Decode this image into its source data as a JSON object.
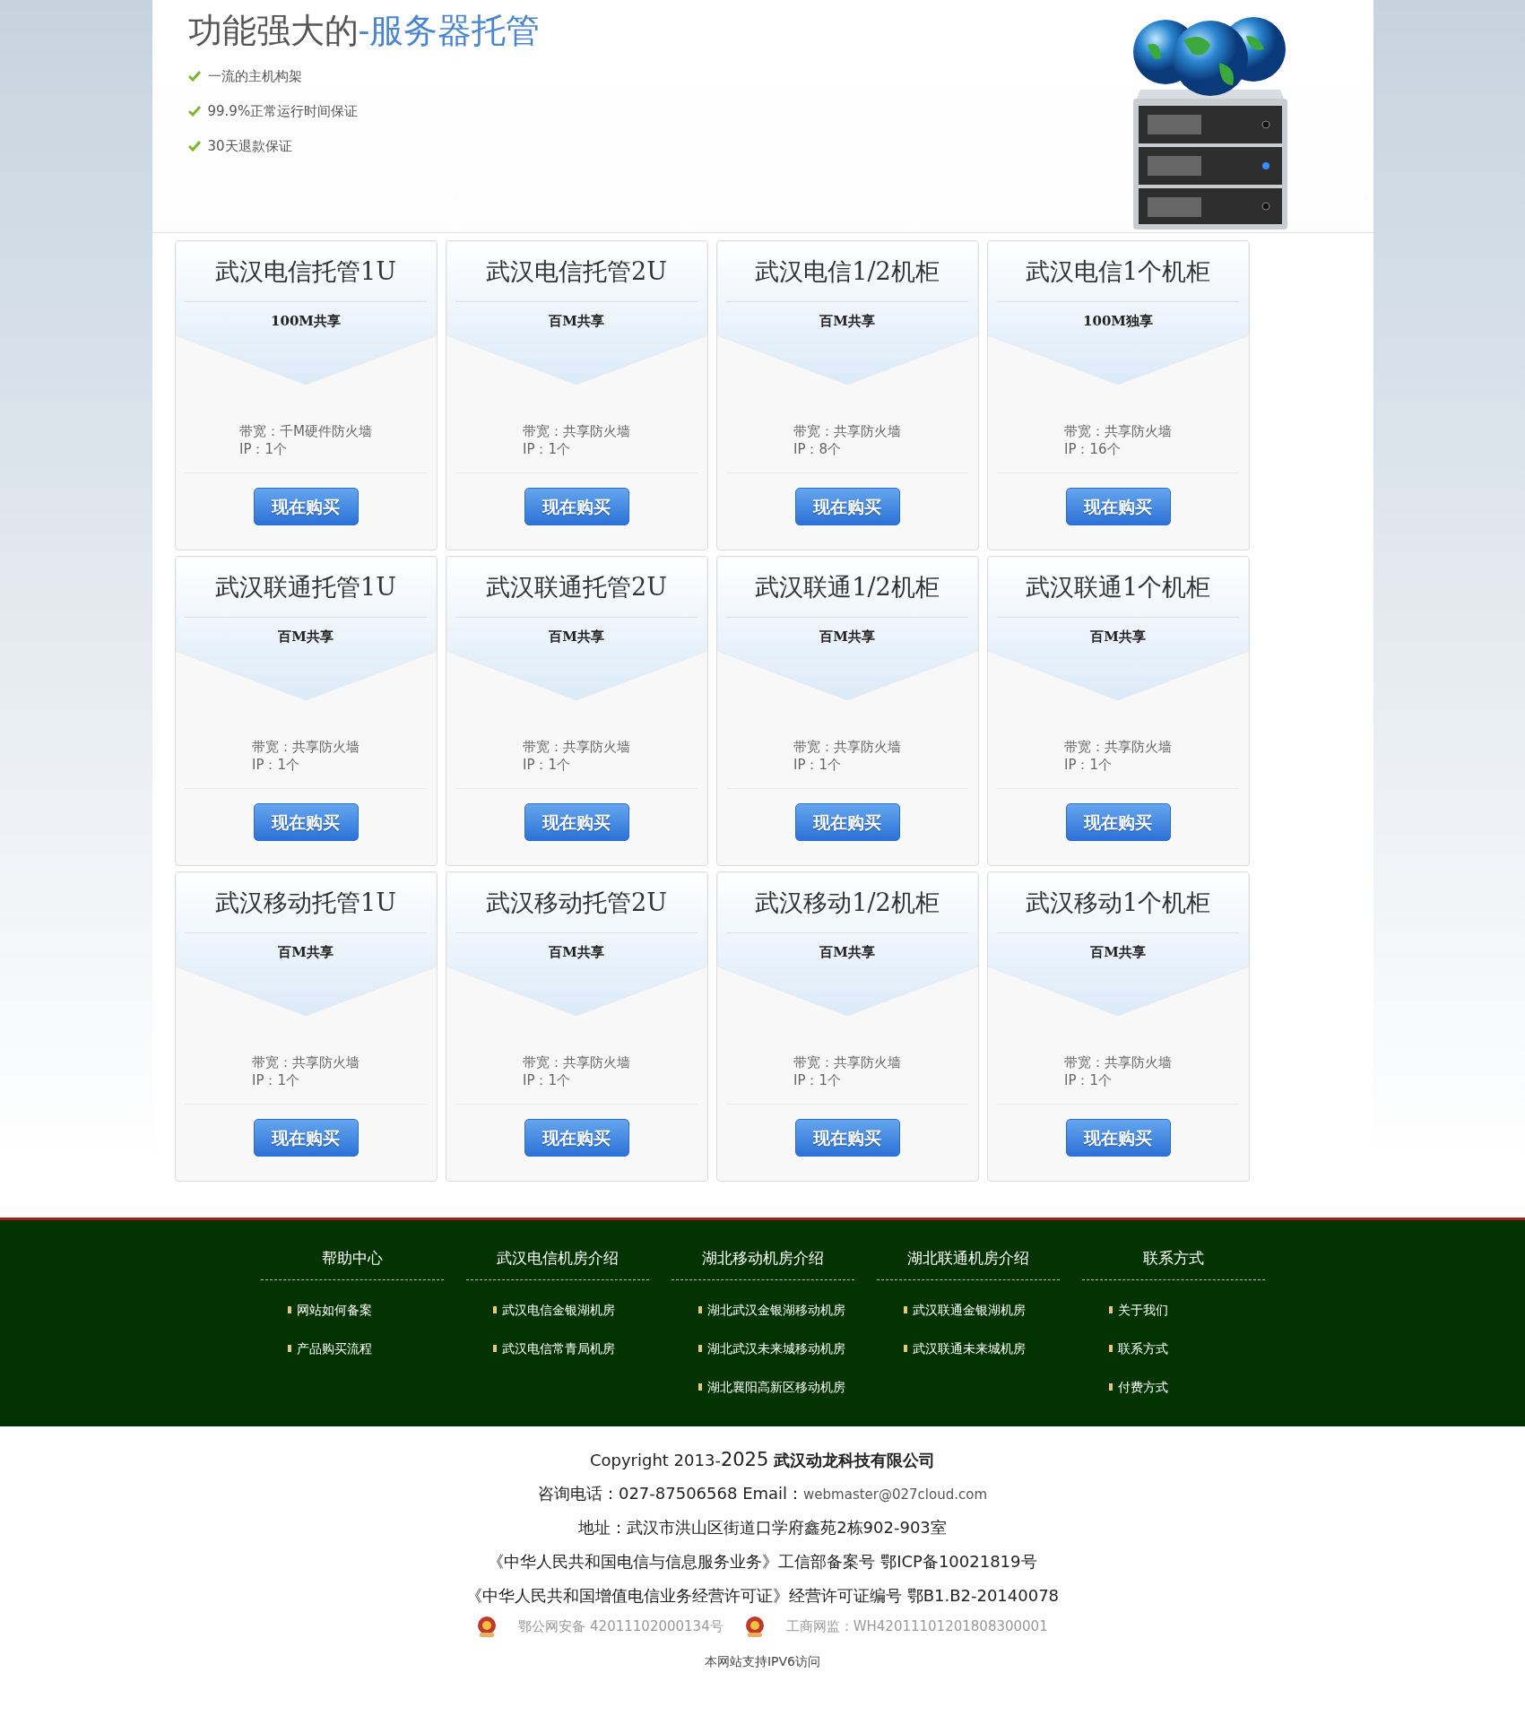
{
  "hero": {
    "title": "功能强大的",
    "title_accent": "-服务器托管",
    "features": [
      "一流的主机构架",
      "99.9%正常运行时间保证",
      "30天退款保证"
    ]
  },
  "plans": [
    {
      "title": "武汉电信托管1U",
      "bandwidth": "100M共享",
      "spec": "带宽：千M硬件防火墙",
      "ip": "IP：1个",
      "button": "现在购买"
    },
    {
      "title": "武汉电信托管2U",
      "bandwidth": "百M共享",
      "spec": "带宽：共享防火墙",
      "ip": "IP：1个",
      "button": "现在购买"
    },
    {
      "title": "武汉电信1/2机柜",
      "bandwidth": "百M共享",
      "spec": "带宽：共享防火墙",
      "ip": "IP：8个",
      "button": "现在购买"
    },
    {
      "title": "武汉电信1个机柜",
      "bandwidth": "100M独享",
      "spec": "带宽：共享防火墙",
      "ip": "IP：16个",
      "button": "现在购买"
    },
    {
      "title": "武汉联通托管1U",
      "bandwidth": "百M共享",
      "spec": "带宽：共享防火墙",
      "ip": "IP：1个",
      "button": "现在购买"
    },
    {
      "title": "武汉联通托管2U",
      "bandwidth": "百M共享",
      "spec": "带宽：共享防火墙",
      "ip": "IP：1个",
      "button": "现在购买"
    },
    {
      "title": "武汉联通1/2机柜",
      "bandwidth": "百M共享",
      "spec": "带宽：共享防火墙",
      "ip": "IP：1个",
      "button": "现在购买"
    },
    {
      "title": "武汉联通1个机柜",
      "bandwidth": "百M共享",
      "spec": "带宽：共享防火墙",
      "ip": "IP：1个",
      "button": "现在购买"
    },
    {
      "title": "武汉移动托管1U",
      "bandwidth": "百M共享",
      "spec": "带宽：共享防火墙",
      "ip": "IP：1个",
      "button": "现在购买"
    },
    {
      "title": "武汉移动托管2U",
      "bandwidth": "百M共享",
      "spec": "带宽：共享防火墙",
      "ip": "IP：1个",
      "button": "现在购买"
    },
    {
      "title": "武汉移动1/2机柜",
      "bandwidth": "百M共享",
      "spec": "带宽：共享防火墙",
      "ip": "IP：1个",
      "button": "现在购买"
    },
    {
      "title": "武汉移动1个机柜",
      "bandwidth": "百M共享",
      "spec": "带宽：共享防火墙",
      "ip": "IP：1个",
      "button": "现在购买"
    }
  ],
  "footer_columns": [
    {
      "heading": "帮助中心",
      "links": [
        "网站如何备案",
        "产品购买流程"
      ]
    },
    {
      "heading": "武汉电信机房介绍",
      "links": [
        "武汉电信金银湖机房",
        "武汉电信常青局机房"
      ]
    },
    {
      "heading": "湖北移动机房介绍",
      "links": [
        "湖北武汉金银湖移动机房",
        "湖北武汉未来城移动机房",
        "湖北襄阳高新区移动机房"
      ]
    },
    {
      "heading": "湖北联通机房介绍",
      "links": [
        "武汉联通金银湖机房",
        "武汉联通未来城机房"
      ]
    },
    {
      "heading": "联系方式",
      "links": [
        "关于我们",
        "联系方式",
        "付费方式"
      ]
    }
  ],
  "bottom": {
    "copyright": "Copyright 2013-",
    "year": "2025",
    "company": "武汉动龙科技有限公司",
    "contact": "咨询电话：027-87506568 Email：",
    "email": "webmaster@027cloud.com",
    "address": "地址：武汉市洪山区街道口学府鑫苑2栋902-903室",
    "licenses": [
      "《中华人民共和国电信与信息服务业务》工信部备案号 鄂ICP备10021819号",
      "《中华人民共和国增值电信业务经营许可证》经营许可证编号 鄂B1.B2-20140078"
    ],
    "badges": [
      "鄂公网安备 42011102000134号",
      "工商网监：WH42011101201808300001"
    ],
    "ipv6": "本网站支持IPV6访问"
  }
}
